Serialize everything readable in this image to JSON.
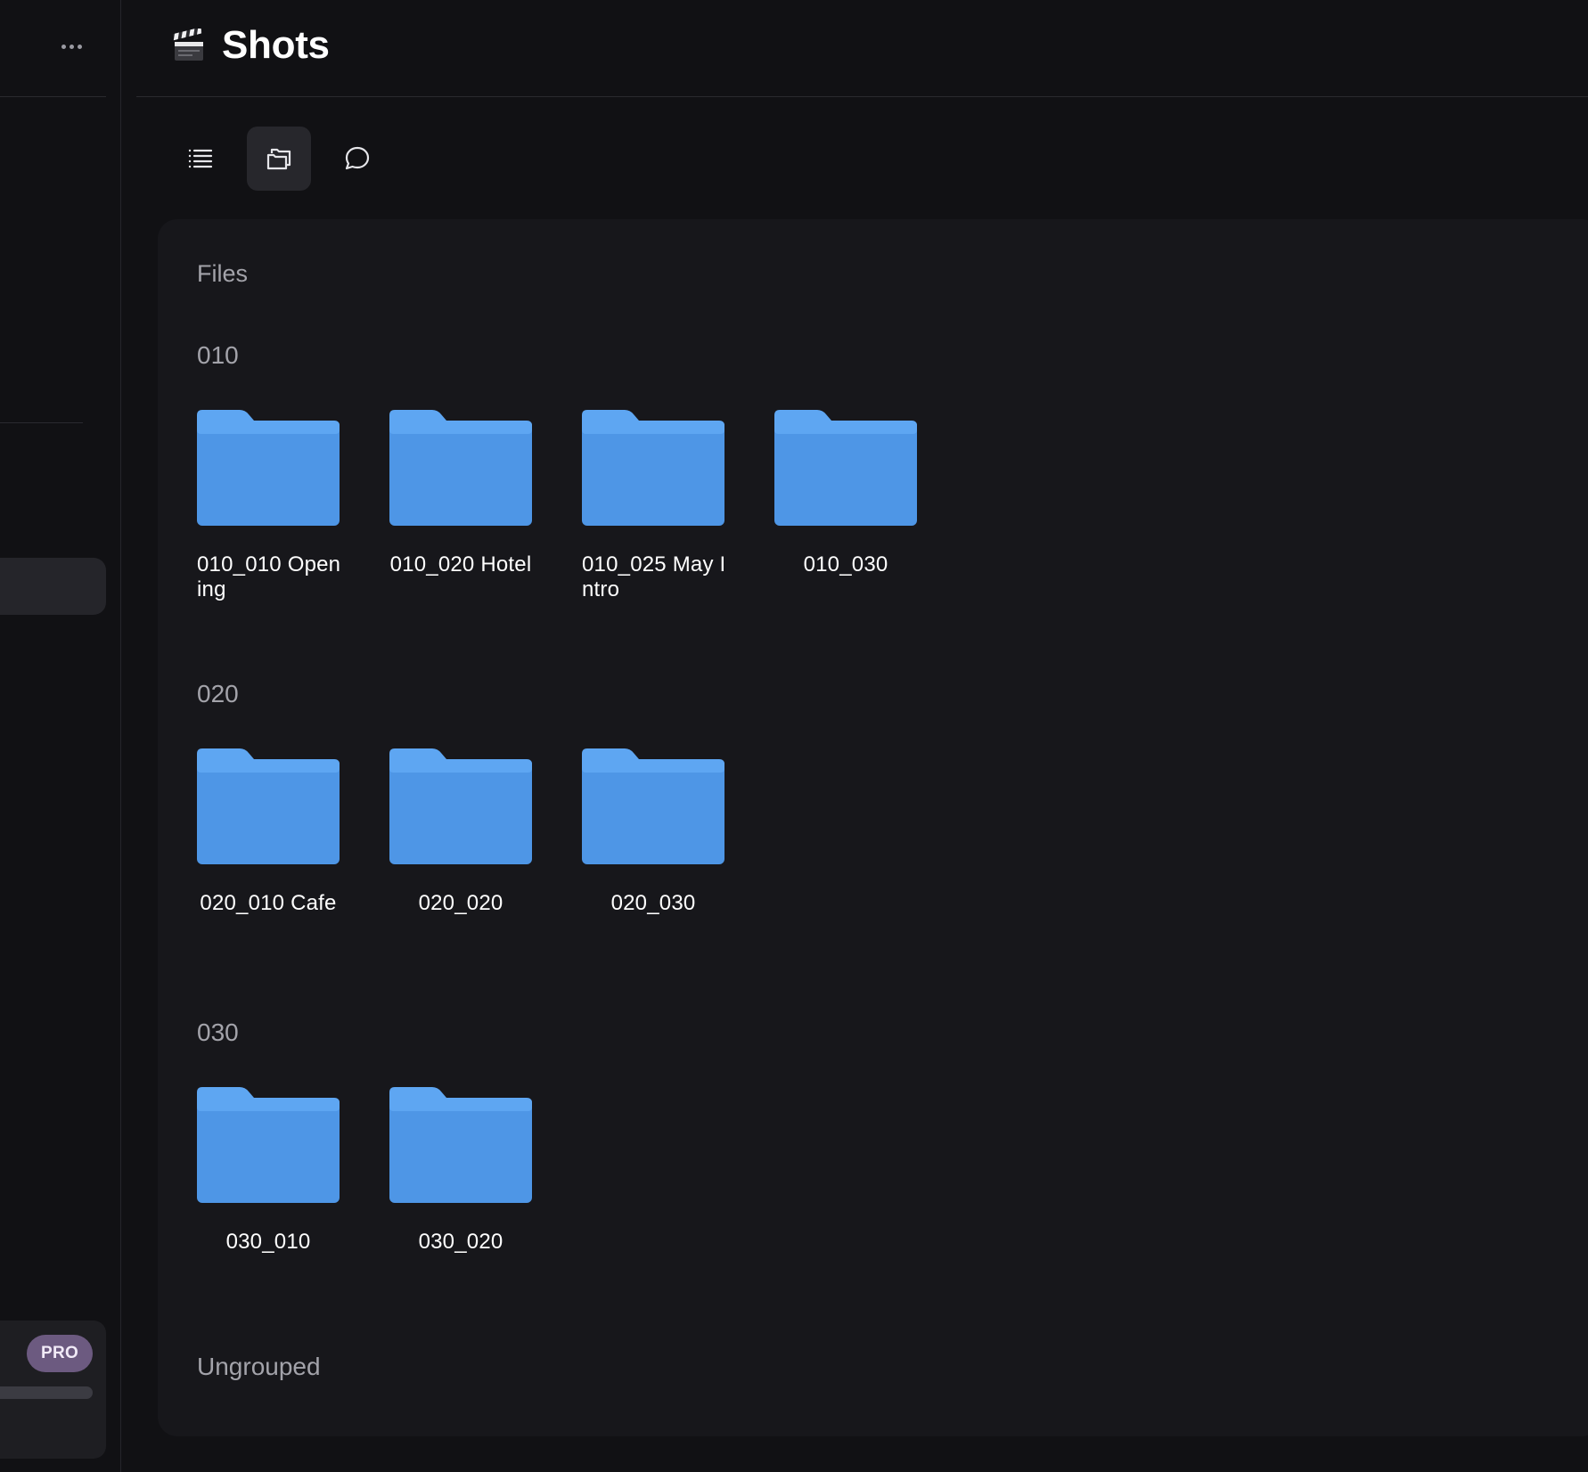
{
  "sidebar": {
    "more_icon": "ellipsis-icon",
    "pro_badge": "PRO"
  },
  "header": {
    "icon": "clapper-board-icon",
    "title": "Shots"
  },
  "view_toolbar": {
    "items": [
      {
        "icon": "list-icon",
        "active": false
      },
      {
        "icon": "folders-icon",
        "active": true
      },
      {
        "icon": "comment-icon",
        "active": false
      }
    ]
  },
  "files": {
    "title": "Files",
    "groups": [
      {
        "name": "010",
        "folders": [
          "010_010 Opening",
          "010_020 Hotel",
          "010_025 May Intro",
          "010_030"
        ]
      },
      {
        "name": "020",
        "folders": [
          "020_010 Cafe",
          "020_020",
          "020_030"
        ]
      },
      {
        "name": "030",
        "folders": [
          "030_010",
          "030_020"
        ]
      }
    ],
    "ungrouped_title": "Ungrouped"
  },
  "colors": {
    "background": "#111114",
    "panel": "#17171b",
    "folder_front": "#4e96e6",
    "folder_back": "#5ea6f2",
    "pro_badge": "#6c5a80"
  }
}
